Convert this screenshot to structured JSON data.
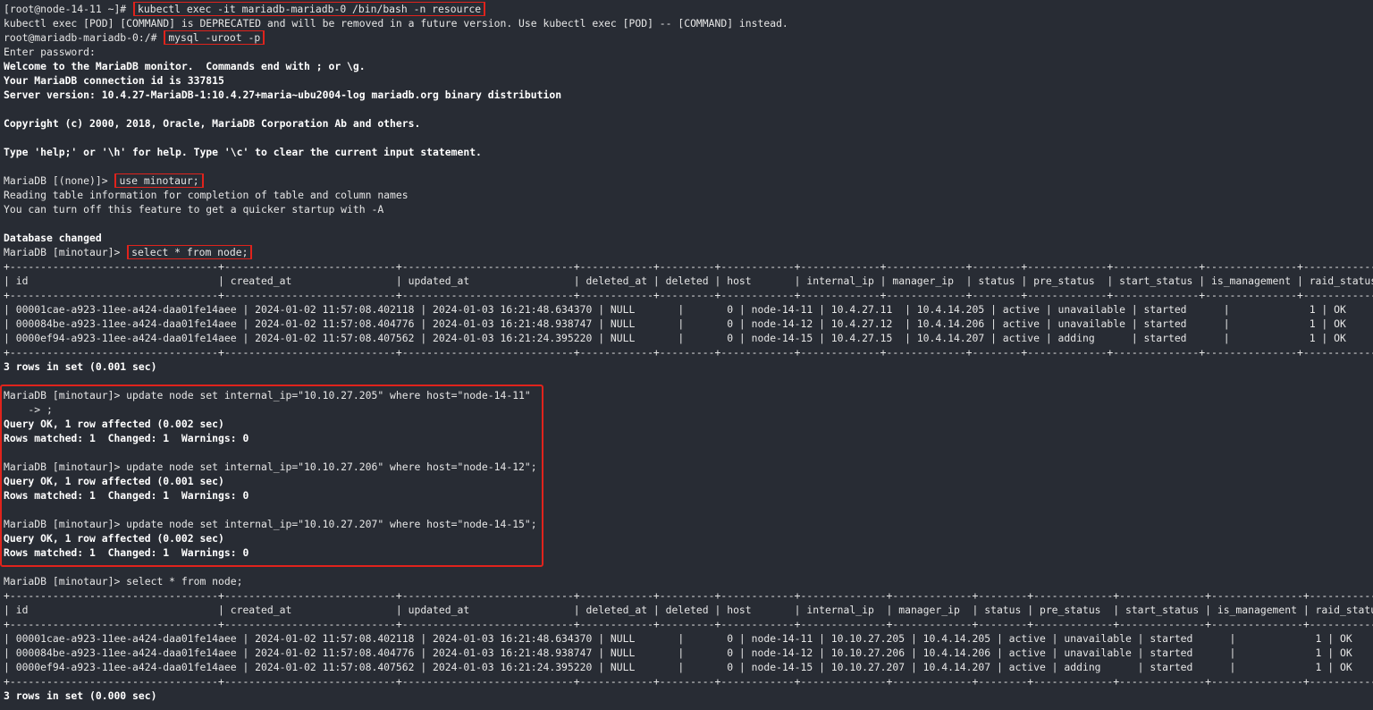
{
  "terminal": {
    "lines": [
      {
        "t": "[root@node-14-11 ~]# ",
        "cmd": "kubectl exec -it mariadb-mariadb-0 /bin/bash -n resource"
      },
      {
        "t": "kubectl exec [POD] [COMMAND] is DEPRECATED and will be removed in a future version. Use kubectl exec [POD] -- [COMMAND] instead."
      },
      {
        "t": "root@mariadb-mariadb-0:/# ",
        "cmd": "mysql -uroot -p"
      },
      {
        "t": "Enter password:"
      },
      {
        "t": "Welcome to the MariaDB monitor.  Commands end with ; or \\g.",
        "bold": true
      },
      {
        "t": "Your MariaDB connection id is 337815",
        "bold": true
      },
      {
        "t": "Server version: 10.4.27-MariaDB-1:10.4.27+maria~ubu2004-log mariadb.org binary distribution",
        "bold": true
      },
      {
        "t": ""
      },
      {
        "t": "Copyright (c) 2000, 2018, Oracle, MariaDB Corporation Ab and others.",
        "bold": true
      },
      {
        "t": ""
      },
      {
        "t": "Type 'help;' or '\\h' for help. Type '\\c' to clear the current input statement.",
        "bold": true
      },
      {
        "t": ""
      },
      {
        "t": "MariaDB [(none)]> ",
        "cmd": "use minotaur;"
      },
      {
        "t": "Reading table information for completion of table and column names"
      },
      {
        "t": "You can turn off this feature to get a quicker startup with -A"
      },
      {
        "t": ""
      },
      {
        "t": "Database changed",
        "bold": true
      },
      {
        "t": "MariaDB [minotaur]> ",
        "cmd": "select * from node;"
      },
      {
        "t": "+----------------------------------+----------------------------+----------------------------+------------+---------+------------+-------------+-------------+--------+-------------+--------------+---------------+-------------+"
      },
      {
        "t": "| id                               | created_at                 | updated_at                 | deleted_at | deleted | host       | internal_ip | manager_ip  | status | pre_status  | start_status | is_management | raid_status |"
      },
      {
        "t": "+----------------------------------+----------------------------+----------------------------+------------+---------+------------+-------------+-------------+--------+-------------+--------------+---------------+-------------+"
      },
      {
        "t": "| 00001cae-a923-11ee-a424-daa01fe14aee | 2024-01-02 11:57:08.402118 | 2024-01-03 16:21:48.634370 | NULL       |       0 | node-14-11 | 10.4.27.11  | 10.4.14.205 | active | unavailable | started      |             1 | OK          |"
      },
      {
        "t": "| 000084be-a923-11ee-a424-daa01fe14aee | 2024-01-02 11:57:08.404776 | 2024-01-03 16:21:48.938747 | NULL       |       0 | node-14-12 | 10.4.27.12  | 10.4.14.206 | active | unavailable | started      |             1 | OK          |"
      },
      {
        "t": "| 0000ef94-a923-11ee-a424-daa01fe14aee | 2024-01-02 11:57:08.407562 | 2024-01-03 16:21:24.395220 | NULL       |       0 | node-14-15 | 10.4.27.15  | 10.4.14.207 | active | adding      | started      |             1 | OK          |"
      },
      {
        "t": "+----------------------------------+----------------------------+----------------------------+------------+---------+------------+-------------+-------------+--------+-------------+--------------+---------------+-------------+"
      },
      {
        "t": "3 rows in set (0.001 sec)",
        "bold": true
      },
      {
        "t": ""
      },
      {
        "t": "MariaDB [minotaur]> update node set internal_ip=\"10.10.27.205\" where host=\"node-14-11\""
      },
      {
        "t": "    -> ;"
      },
      {
        "t": "Query OK, 1 row affected (0.002 sec)",
        "bold": true
      },
      {
        "t": "Rows matched: 1  Changed: 1  Warnings: 0",
        "bold": true
      },
      {
        "t": ""
      },
      {
        "t": "MariaDB [minotaur]> update node set internal_ip=\"10.10.27.206\" where host=\"node-14-12\";"
      },
      {
        "t": "Query OK, 1 row affected (0.001 sec)",
        "bold": true
      },
      {
        "t": "Rows matched: 1  Changed: 1  Warnings: 0",
        "bold": true
      },
      {
        "t": ""
      },
      {
        "t": "MariaDB [minotaur]> update node set internal_ip=\"10.10.27.207\" where host=\"node-14-15\";"
      },
      {
        "t": "Query OK, 1 row affected (0.002 sec)",
        "bold": true
      },
      {
        "t": "Rows matched: 1  Changed: 1  Warnings: 0",
        "bold": true
      },
      {
        "t": ""
      },
      {
        "t": "MariaDB [minotaur]> select * from node;"
      },
      {
        "t": "+----------------------------------+----------------------------+----------------------------+------------+---------+------------+--------------+-------------+--------+-------------+--------------+---------------+-------------+"
      },
      {
        "t": "| id                               | created_at                 | updated_at                 | deleted_at | deleted | host       | internal_ip  | manager_ip  | status | pre_status  | start_status | is_management | raid_status |"
      },
      {
        "t": "+----------------------------------+----------------------------+----------------------------+------------+---------+------------+--------------+-------------+--------+-------------+--------------+---------------+-------------+"
      },
      {
        "t": "| 00001cae-a923-11ee-a424-daa01fe14aee | 2024-01-02 11:57:08.402118 | 2024-01-03 16:21:48.634370 | NULL       |       0 | node-14-11 | 10.10.27.205 | 10.4.14.205 | active | unavailable | started      |             1 | OK          |"
      },
      {
        "t": "| 000084be-a923-11ee-a424-daa01fe14aee | 2024-01-02 11:57:08.404776 | 2024-01-03 16:21:48.938747 | NULL       |       0 | node-14-12 | 10.10.27.206 | 10.4.14.206 | active | unavailable | started      |             1 | OK          |"
      },
      {
        "t": "| 0000ef94-a923-11ee-a424-daa01fe14aee | 2024-01-02 11:57:08.407562 | 2024-01-03 16:21:24.395220 | NULL       |       0 | node-14-15 | 10.10.27.207 | 10.4.14.207 | active | adding      | started      |             1 | OK          |"
      },
      {
        "t": "+----------------------------------+----------------------------+----------------------------+------------+---------+------------+--------------+-------------+--------+-------------+--------------+---------------+-------------+"
      },
      {
        "t": "3 rows in set (0.000 sec)",
        "bold": true
      }
    ]
  },
  "colors": {
    "background": "#282c34",
    "text": "#e6e6e6",
    "highlight_border": "#e0231c"
  }
}
